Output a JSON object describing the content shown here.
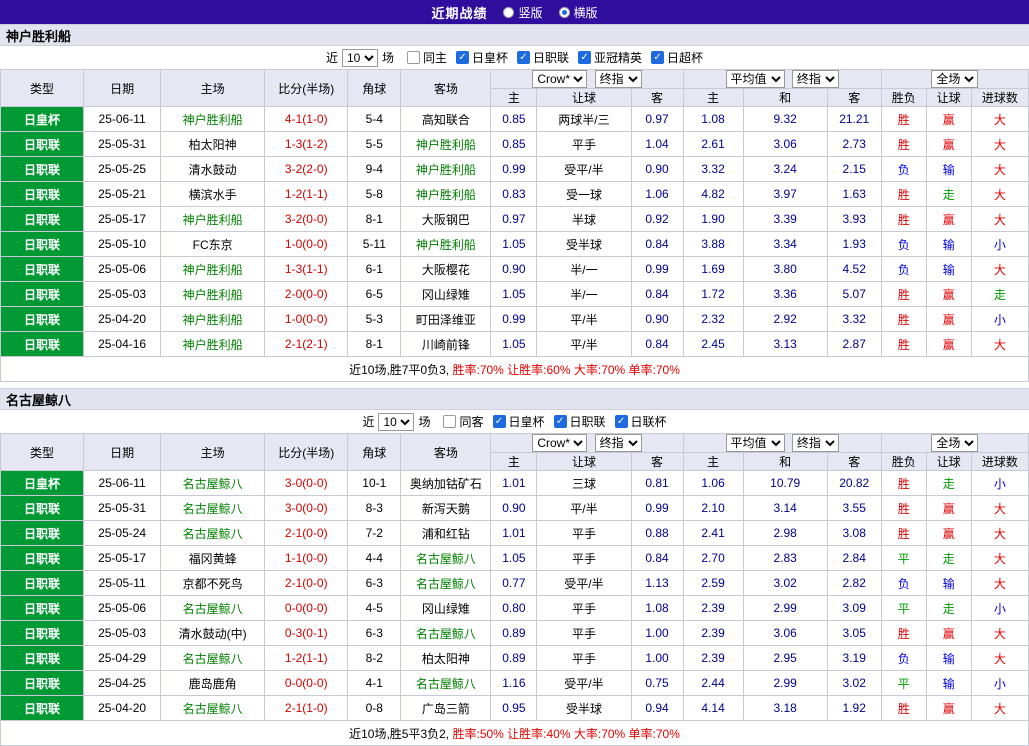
{
  "topbar": {
    "title": "近期战绩",
    "layout_options": [
      {
        "label": "竖版",
        "selected": false
      },
      {
        "label": "横版",
        "selected": true
      }
    ]
  },
  "colors": {
    "topbar_bg": "#2f0e9d",
    "header_bg": "#e7e7f3",
    "team_bar_bg": "#e3e3ef",
    "league_cell_bg": "#009933",
    "featured_team_green": "#008000",
    "score_red": "#d40000",
    "odds_navy": "#00008b",
    "win_red": "#e60000",
    "push_green": "#009900",
    "loss_blue": "#0000e6",
    "checkbox_blue": "#1e6ae1"
  },
  "result_color_class": {
    "胜": "r-red",
    "赢": "r-red",
    "大": "r-red",
    "平": "r-green",
    "走": "r-green",
    "负": "r-blue",
    "输": "r-blue",
    "小": "r-blue"
  },
  "table_header": {
    "static_cols": [
      "类型",
      "日期",
      "主场",
      "比分(半场)",
      "角球",
      "客场"
    ],
    "book_label": "Crow*",
    "stage_label": "终指",
    "avg_label": "平均值",
    "scope_label": "全场",
    "sub_cols": [
      "主",
      "让球",
      "客",
      "主",
      "和",
      "客",
      "胜负",
      "让球",
      "进球数"
    ]
  },
  "sections": [
    {
      "team": "神户胜利船",
      "filters": {
        "prefix": "近",
        "count": "10",
        "suffix": "场",
        "options": [
          {
            "label": "同主",
            "checked": false
          },
          {
            "label": "日皇杯",
            "checked": true
          },
          {
            "label": "日职联",
            "checked": true
          },
          {
            "label": "亚冠精英",
            "checked": true
          },
          {
            "label": "日超杯",
            "checked": true
          }
        ]
      },
      "rows": [
        {
          "type": "日皇杯",
          "date": "25-06-11",
          "home": "神户胜利船",
          "home_featured": true,
          "score": "4-1(1-0)",
          "corners": "5-4",
          "away": "高知联合",
          "away_featured": false,
          "odds": [
            "0.85",
            "两球半/三",
            "0.97"
          ],
          "avg": [
            "1.08",
            "9.32",
            "21.21"
          ],
          "results": [
            "胜",
            "赢",
            "大"
          ]
        },
        {
          "type": "日职联",
          "date": "25-05-31",
          "home": "柏太阳神",
          "home_featured": false,
          "score": "1-3(1-2)",
          "corners": "5-5",
          "away": "神户胜利船",
          "away_featured": true,
          "odds": [
            "0.85",
            "平手",
            "1.04"
          ],
          "avg": [
            "2.61",
            "3.06",
            "2.73"
          ],
          "results": [
            "胜",
            "赢",
            "大"
          ]
        },
        {
          "type": "日职联",
          "date": "25-05-25",
          "home": "清水鼓动",
          "home_featured": false,
          "score": "3-2(2-0)",
          "corners": "9-4",
          "away": "神户胜利船",
          "away_featured": true,
          "odds": [
            "0.99",
            "受平/半",
            "0.90"
          ],
          "avg": [
            "3.32",
            "3.24",
            "2.15"
          ],
          "results": [
            "负",
            "输",
            "大"
          ]
        },
        {
          "type": "日职联",
          "date": "25-05-21",
          "home": "横滨水手",
          "home_featured": false,
          "score": "1-2(1-1)",
          "corners": "5-8",
          "away": "神户胜利船",
          "away_featured": true,
          "odds": [
            "0.83",
            "受一球",
            "1.06"
          ],
          "avg": [
            "4.82",
            "3.97",
            "1.63"
          ],
          "results": [
            "胜",
            "走",
            "大"
          ]
        },
        {
          "type": "日职联",
          "date": "25-05-17",
          "home": "神户胜利船",
          "home_featured": true,
          "score": "3-2(0-0)",
          "corners": "8-1",
          "away": "大阪钢巴",
          "away_featured": false,
          "odds": [
            "0.97",
            "半球",
            "0.92"
          ],
          "avg": [
            "1.90",
            "3.39",
            "3.93"
          ],
          "results": [
            "胜",
            "赢",
            "大"
          ]
        },
        {
          "type": "日职联",
          "date": "25-05-10",
          "home": "FC东京",
          "home_featured": false,
          "score": "1-0(0-0)",
          "corners": "5-11",
          "away": "神户胜利船",
          "away_featured": true,
          "odds": [
            "1.05",
            "受半球",
            "0.84"
          ],
          "avg": [
            "3.88",
            "3.34",
            "1.93"
          ],
          "results": [
            "负",
            "输",
            "小"
          ]
        },
        {
          "type": "日职联",
          "date": "25-05-06",
          "home": "神户胜利船",
          "home_featured": true,
          "score": "1-3(1-1)",
          "corners": "6-1",
          "away": "大阪樱花",
          "away_featured": false,
          "odds": [
            "0.90",
            "半/一",
            "0.99"
          ],
          "avg": [
            "1.69",
            "3.80",
            "4.52"
          ],
          "results": [
            "负",
            "输",
            "大"
          ]
        },
        {
          "type": "日职联",
          "date": "25-05-03",
          "home": "神户胜利船",
          "home_featured": true,
          "score": "2-0(0-0)",
          "corners": "6-5",
          "away": "冈山绿雉",
          "away_featured": false,
          "odds": [
            "1.05",
            "半/一",
            "0.84"
          ],
          "avg": [
            "1.72",
            "3.36",
            "5.07"
          ],
          "results": [
            "胜",
            "赢",
            "走"
          ]
        },
        {
          "type": "日职联",
          "date": "25-04-20",
          "home": "神户胜利船",
          "home_featured": true,
          "score": "1-0(0-0)",
          "corners": "5-3",
          "away": "町田泽维亚",
          "away_featured": false,
          "odds": [
            "0.99",
            "平/半",
            "0.90"
          ],
          "avg": [
            "2.32",
            "2.92",
            "3.32"
          ],
          "results": [
            "胜",
            "赢",
            "小"
          ]
        },
        {
          "type": "日职联",
          "date": "25-04-16",
          "home": "神户胜利船",
          "home_featured": true,
          "score": "2-1(2-1)",
          "corners": "8-1",
          "away": "川崎前锋",
          "away_featured": false,
          "odds": [
            "1.05",
            "平/半",
            "0.84"
          ],
          "avg": [
            "2.45",
            "3.13",
            "2.87"
          ],
          "results": [
            "胜",
            "赢",
            "大"
          ]
        }
      ],
      "summary": {
        "record": "近10场,胜7平0负3,",
        "rates": "胜率:70% 让胜率:60% 大率:70% 单率:70%"
      }
    },
    {
      "team": "名古屋鲸八",
      "filters": {
        "prefix": "近",
        "count": "10",
        "suffix": "场",
        "options": [
          {
            "label": "同客",
            "checked": false
          },
          {
            "label": "日皇杯",
            "checked": true
          },
          {
            "label": "日职联",
            "checked": true
          },
          {
            "label": "日联杯",
            "checked": true
          }
        ]
      },
      "rows": [
        {
          "type": "日皇杯",
          "date": "25-06-11",
          "home": "名古屋鲸八",
          "home_featured": true,
          "score": "3-0(0-0)",
          "corners": "10-1",
          "away": "奥纳加钴矿石",
          "away_featured": false,
          "odds": [
            "1.01",
            "三球",
            "0.81"
          ],
          "avg": [
            "1.06",
            "10.79",
            "20.82"
          ],
          "results": [
            "胜",
            "走",
            "小"
          ]
        },
        {
          "type": "日职联",
          "date": "25-05-31",
          "home": "名古屋鲸八",
          "home_featured": true,
          "score": "3-0(0-0)",
          "corners": "8-3",
          "away": "新泻天鹅",
          "away_featured": false,
          "odds": [
            "0.90",
            "平/半",
            "0.99"
          ],
          "avg": [
            "2.10",
            "3.14",
            "3.55"
          ],
          "results": [
            "胜",
            "赢",
            "大"
          ]
        },
        {
          "type": "日职联",
          "date": "25-05-24",
          "home": "名古屋鲸八",
          "home_featured": true,
          "score": "2-1(0-0)",
          "corners": "7-2",
          "away": "浦和红钻",
          "away_featured": false,
          "odds": [
            "1.01",
            "平手",
            "0.88"
          ],
          "avg": [
            "2.41",
            "2.98",
            "3.08"
          ],
          "results": [
            "胜",
            "赢",
            "大"
          ]
        },
        {
          "type": "日职联",
          "date": "25-05-17",
          "home": "福冈黄蜂",
          "home_featured": false,
          "score": "1-1(0-0)",
          "corners": "4-4",
          "away": "名古屋鲸八",
          "away_featured": true,
          "odds": [
            "1.05",
            "平手",
            "0.84"
          ],
          "avg": [
            "2.70",
            "2.83",
            "2.84"
          ],
          "results": [
            "平",
            "走",
            "大"
          ]
        },
        {
          "type": "日职联",
          "date": "25-05-11",
          "home": "京都不死鸟",
          "home_featured": false,
          "score": "2-1(0-0)",
          "corners": "6-3",
          "away": "名古屋鲸八",
          "away_featured": true,
          "odds": [
            "0.77",
            "受平/半",
            "1.13"
          ],
          "avg": [
            "2.59",
            "3.02",
            "2.82"
          ],
          "results": [
            "负",
            "输",
            "大"
          ]
        },
        {
          "type": "日职联",
          "date": "25-05-06",
          "home": "名古屋鲸八",
          "home_featured": true,
          "score": "0-0(0-0)",
          "corners": "4-5",
          "away": "冈山绿雉",
          "away_featured": false,
          "odds": [
            "0.80",
            "平手",
            "1.08"
          ],
          "avg": [
            "2.39",
            "2.99",
            "3.09"
          ],
          "results": [
            "平",
            "走",
            "小"
          ]
        },
        {
          "type": "日职联",
          "date": "25-05-03",
          "home": "清水鼓动(中)",
          "home_featured": false,
          "score": "0-3(0-1)",
          "corners": "6-3",
          "away": "名古屋鲸八",
          "away_featured": true,
          "odds": [
            "0.89",
            "平手",
            "1.00"
          ],
          "avg": [
            "2.39",
            "3.06",
            "3.05"
          ],
          "results": [
            "胜",
            "赢",
            "大"
          ]
        },
        {
          "type": "日职联",
          "date": "25-04-29",
          "home": "名古屋鲸八",
          "home_featured": true,
          "score": "1-2(1-1)",
          "corners": "8-2",
          "away": "柏太阳神",
          "away_featured": false,
          "odds": [
            "0.89",
            "平手",
            "1.00"
          ],
          "avg": [
            "2.39",
            "2.95",
            "3.19"
          ],
          "results": [
            "负",
            "输",
            "大"
          ]
        },
        {
          "type": "日职联",
          "date": "25-04-25",
          "home": "鹿岛鹿角",
          "home_featured": false,
          "score": "0-0(0-0)",
          "corners": "4-1",
          "away": "名古屋鲸八",
          "away_featured": true,
          "odds": [
            "1.16",
            "受平/半",
            "0.75"
          ],
          "avg": [
            "2.44",
            "2.99",
            "3.02"
          ],
          "results": [
            "平",
            "输",
            "小"
          ]
        },
        {
          "type": "日职联",
          "date": "25-04-20",
          "home": "名古屋鲸八",
          "home_featured": true,
          "score": "2-1(1-0)",
          "corners": "0-8",
          "away": "广岛三箭",
          "away_featured": false,
          "odds": [
            "0.95",
            "受半球",
            "0.94"
          ],
          "avg": [
            "4.14",
            "3.18",
            "1.92"
          ],
          "results": [
            "胜",
            "赢",
            "大"
          ]
        }
      ],
      "summary": {
        "record": "近10场,胜5平3负2,",
        "rates": "胜率:50% 让胜率:40% 大率:70% 单率:70%"
      }
    }
  ]
}
